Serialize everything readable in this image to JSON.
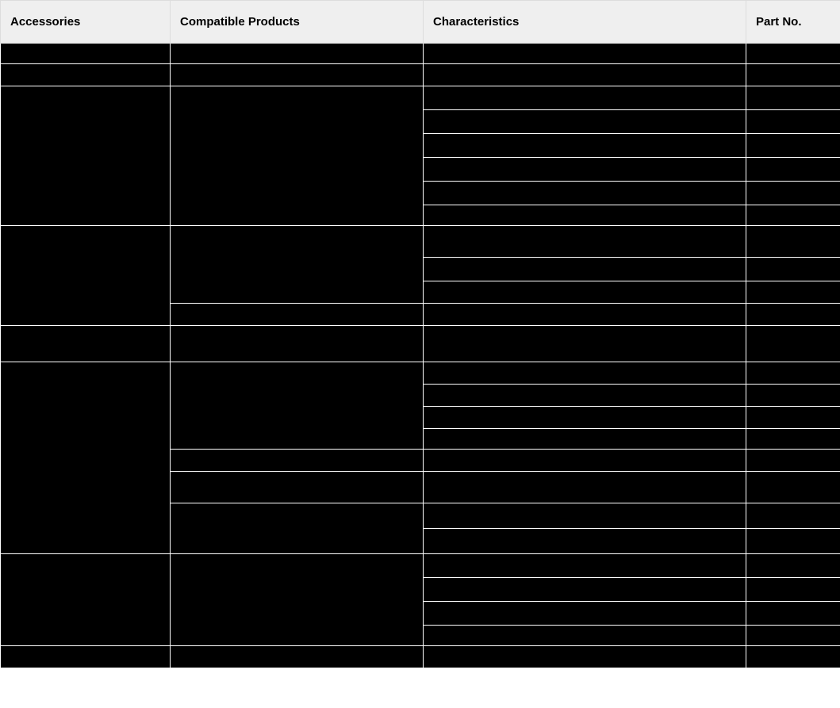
{
  "table": {
    "headers": {
      "accessories": "Accessories",
      "compatible": "Compatible Products",
      "characteristics": "Characteristics",
      "part_no": "Part No."
    }
  }
}
